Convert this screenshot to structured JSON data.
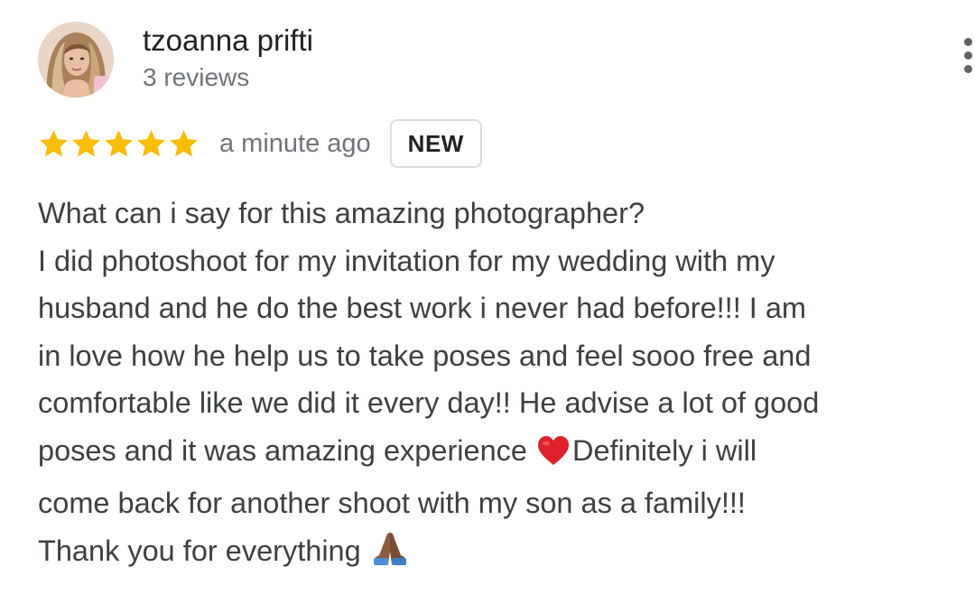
{
  "review": {
    "reviewer_name": "tzoanna prifti",
    "review_count": "3 reviews",
    "rating": 5,
    "rating_max": 5,
    "time_ago": "a minute ago",
    "badge": "NEW",
    "text_lines": [
      "What can i say for this amazing photographer?",
      "I did photoshoot for my invitation for my wedding with my",
      "husband and he do the best work i never had before!!! I am",
      "in love how he help us to take poses and feel sooo free and",
      "comfortable like we did it every day!! He advise a lot of good",
      "poses and it was amazing experience",
      "Definitely i will",
      "come back for another shoot with my son as a family!!!",
      "Thank you for everything"
    ],
    "emojis": [
      "heart-emoji",
      "folded-hands-emoji"
    ]
  },
  "colors": {
    "star": "#fbbc04",
    "name": "#202124",
    "secondary_text": "#70757a",
    "body_text": "#3c4043",
    "badge_border": "#dadce0",
    "heart": "#e0202b"
  },
  "icons": {
    "menu": "more-vert-icon",
    "star": "star-icon"
  }
}
